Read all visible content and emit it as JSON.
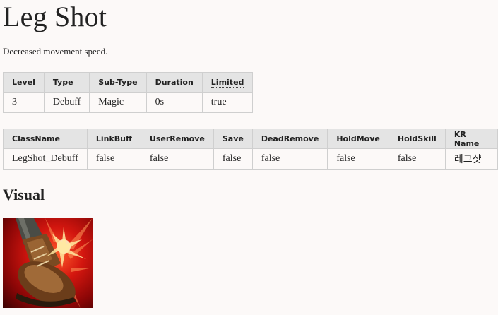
{
  "page": {
    "title": "Leg Shot",
    "description": "Decreased movement speed."
  },
  "info_table": {
    "headers": [
      "Level",
      "Type",
      "Sub-Type",
      "Duration",
      "Limited"
    ],
    "row": [
      "3",
      "Debuff",
      "Magic",
      "0s",
      "true"
    ]
  },
  "props_table": {
    "headers": [
      "ClassName",
      "LinkBuff",
      "UserRemove",
      "Save",
      "DeadRemove",
      "HoldMove",
      "HoldSkill",
      "KR Name"
    ],
    "row": [
      "LegShot_Debuff",
      "false",
      "false",
      "false",
      "false",
      "false",
      "false",
      "레그샷"
    ]
  },
  "visual": {
    "heading": "Visual",
    "icon": "boot-kick-icon"
  },
  "colors": {
    "background": "#fcf9f8",
    "header_bg": "#e4e4e4",
    "border": "#cfcfcf"
  }
}
